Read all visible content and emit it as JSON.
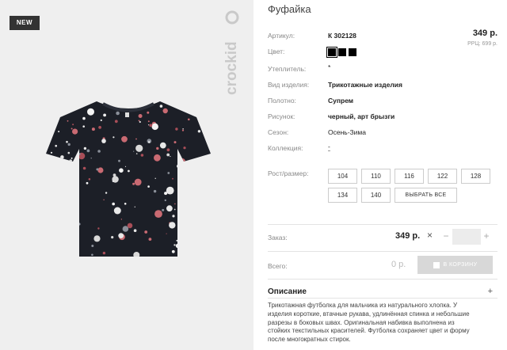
{
  "product": {
    "badge": "NEW",
    "brand": "crockid",
    "title": "Фуфайка",
    "price": "349 р.",
    "rrc": "РРЦ: 699 р."
  },
  "attributes": {
    "article": {
      "label": "Артикул:",
      "value": "К 302128"
    },
    "color": {
      "label": "Цвет:"
    },
    "insulation": {
      "label": "Утеплитель:",
      "value": "*"
    },
    "kind": {
      "label": "Вид изделия:",
      "value": "Трикотажные изделия"
    },
    "fabric": {
      "label": "Полотно:",
      "value": "Супрем"
    },
    "pattern": {
      "label": "Рисунок:",
      "value": "черный, арт брызги"
    },
    "season": {
      "label": "Сезон:",
      "value": "Осень-Зима"
    },
    "collection": {
      "label": "Коллекция:",
      "value": "-"
    }
  },
  "swatches": [
    {
      "color": "#000000",
      "selected": true
    },
    {
      "color": "#000000",
      "selected": false
    },
    {
      "color": "#000000",
      "selected": false
    }
  ],
  "sizes": {
    "label": "Рост/размер:",
    "options": [
      "104",
      "110",
      "116",
      "122",
      "128",
      "134",
      "140"
    ],
    "select_all": "ВЫБРАТЬ ВСЕ"
  },
  "order": {
    "label": "Заказ:",
    "price": "349 р.",
    "times": "×",
    "minus": "−",
    "plus": "+",
    "qty": ""
  },
  "total": {
    "label": "Всего:",
    "price": "0 р.",
    "cart_button": "В КОРЗИНУ"
  },
  "description": {
    "header": "Описание",
    "toggle": "+",
    "lines": [
      "Трикотажная футболка для мальчика из натурального хлопка. У",
      "изделия короткие, втачные рукава, удлинённая спинка и небольшие",
      "разрезы в боковых швах. Оригинальная набивка выполнена из",
      "стойких текстильных красителей. Футболка сохраняет цвет и форму",
      "после многократных стирок."
    ]
  }
}
